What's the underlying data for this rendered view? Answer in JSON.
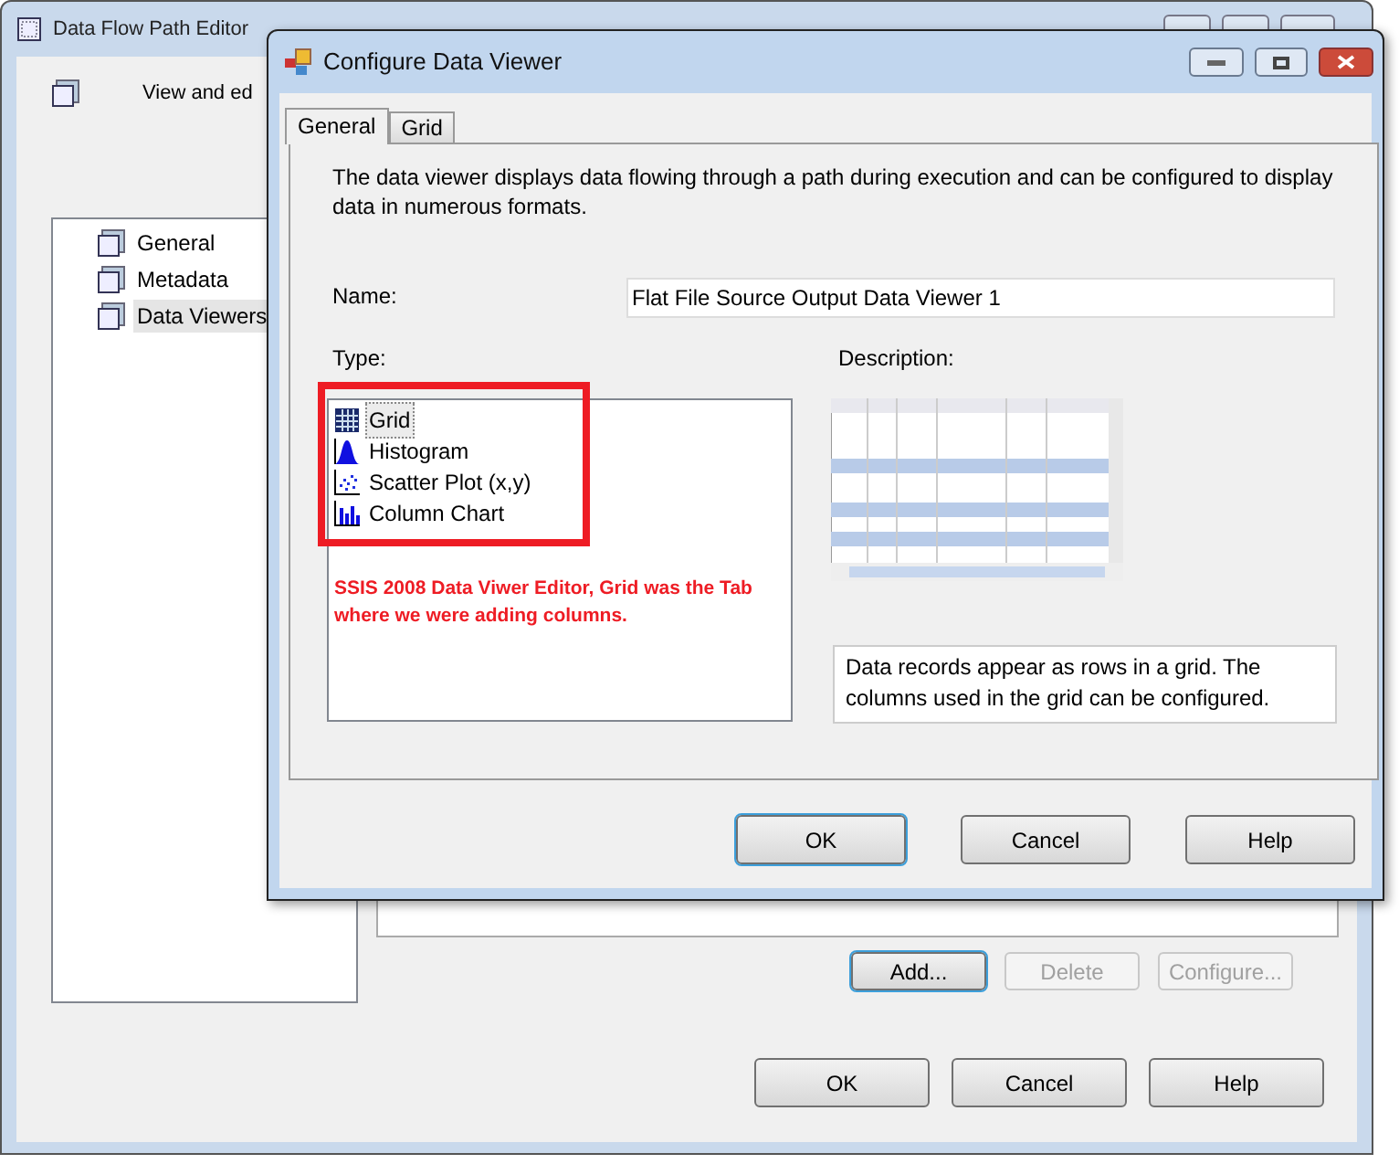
{
  "main_window": {
    "title": "Data Flow Path Editor",
    "header_text": "View and ed",
    "tree": [
      {
        "label": "General",
        "selected": false
      },
      {
        "label": "Metadata",
        "selected": false
      },
      {
        "label": "Data Viewers",
        "selected": true
      }
    ],
    "list_buttons": [
      {
        "label": "Add...",
        "disabled": false
      },
      {
        "label": "Delete",
        "disabled": true
      },
      {
        "label": "Configure...",
        "disabled": true
      }
    ],
    "buttons": [
      "OK",
      "Cancel",
      "Help"
    ]
  },
  "dialog": {
    "title": "Configure Data Viewer",
    "tabs": [
      {
        "label": "General",
        "selected": true
      },
      {
        "label": "Grid",
        "selected": false
      }
    ],
    "intro": "The data viewer displays data flowing through a path during execution and can be configured to display data in numerous formats.",
    "name_label": "Name:",
    "name_value": "Flat File Source Output Data Viewer 1",
    "type_label": "Type:",
    "types": [
      {
        "label": "Grid",
        "kind": "grid",
        "selected": true
      },
      {
        "label": "Histogram",
        "kind": "histogram",
        "selected": false
      },
      {
        "label": "Scatter Plot (x,y)",
        "kind": "scatter",
        "selected": false
      },
      {
        "label": "Column Chart",
        "kind": "column",
        "selected": false
      }
    ],
    "annotation": "SSIS 2008 Data Viwer Editor, Grid was the Tab where we were adding columns.",
    "description_label": "Description:",
    "description": "Data records appear as rows in a grid. The columns used in the grid can be configured.",
    "buttons": [
      "OK",
      "Cancel",
      "Help"
    ]
  }
}
